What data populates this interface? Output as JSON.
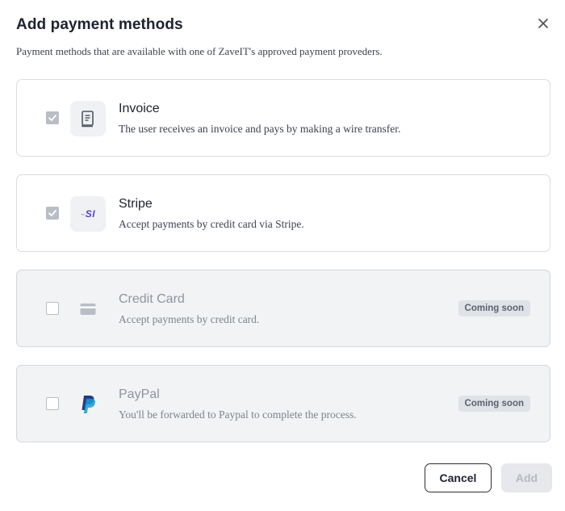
{
  "dialog": {
    "title": "Add payment methods",
    "subtitle": "Payment methods that are available with one of ZaveIT's approved payment proveders."
  },
  "methods": [
    {
      "title": "Invoice",
      "description": "The user receives an invoice and pays by making a wire transfer.",
      "checked": true,
      "disabled": false,
      "icon": "receipt-icon"
    },
    {
      "title": "Stripe",
      "description": "Accept payments by credit card via Stripe.",
      "checked": true,
      "disabled": false,
      "icon": "stripe-logo-icon",
      "icon_text": "SI"
    },
    {
      "title": "Credit Card",
      "description": "Accept payments by credit card.",
      "checked": false,
      "disabled": true,
      "icon": "credit-card-icon",
      "badge": "Coming soon"
    },
    {
      "title": "PayPal",
      "description": "You'll be forwarded to Paypal to complete the process.",
      "checked": false,
      "disabled": true,
      "icon": "paypal-logo-icon",
      "badge": "Coming soon"
    }
  ],
  "footer": {
    "cancel_label": "Cancel",
    "add_label": "Add"
  },
  "colors": {
    "stripe_accent": "#635bff",
    "paypal_dark": "#253b80",
    "paypal_light": "#179bd7"
  }
}
